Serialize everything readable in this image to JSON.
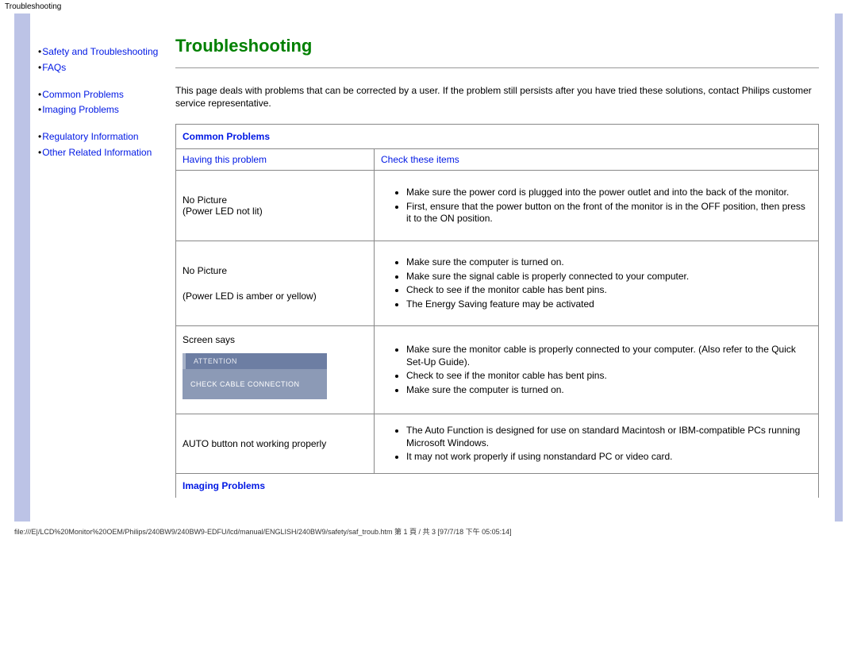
{
  "top_label": "Troubleshooting",
  "sidebar": {
    "links": [
      {
        "label": "Safety and Troubleshooting"
      },
      {
        "label": "FAQs"
      },
      {
        "label": "Common Problems"
      },
      {
        "label": "Imaging Problems"
      },
      {
        "label": "Regulatory Information"
      },
      {
        "label": "Other Related Information"
      }
    ]
  },
  "main": {
    "title": "Troubleshooting",
    "intro": "This page deals with problems that can be corrected by a user. If the problem still persists after you have tried these solutions, contact Philips customer service representative.",
    "sections": {
      "common": {
        "heading": "Common Problems",
        "col_left": "Having this problem",
        "col_right": "Check these items",
        "rows": [
          {
            "problem_line1": "No Picture",
            "problem_line2": "(Power LED not lit)",
            "items": [
              "Make sure the power cord is plugged into the power outlet and into the back of the monitor.",
              "First, ensure that the power button on the front of the monitor is in the OFF position, then press it to the ON position."
            ]
          },
          {
            "problem_line1": "No Picture",
            "problem_line2": "(Power LED is amber or yellow)",
            "items": [
              "Make sure the computer is turned on.",
              "Make sure the signal cable is properly connected to your computer.",
              "Check to see if the monitor cable has bent pins.",
              "The Energy Saving feature may be activated"
            ]
          },
          {
            "problem_line1": "Screen says",
            "attention_head": "ATTENTION",
            "attention_body": "CHECK CABLE CONNECTION",
            "items": [
              "Make sure the monitor cable is properly connected to your computer. (Also refer to the Quick Set-Up Guide).",
              "Check to see if the monitor cable has bent pins.",
              "Make sure the computer is turned on."
            ]
          },
          {
            "problem_line1": "AUTO button not working properly",
            "items": [
              "The Auto Function is designed for use on standard Macintosh or IBM-compatible PCs running Microsoft Windows.",
              "It may not work properly if using nonstandard PC or video card."
            ]
          }
        ]
      },
      "imaging": {
        "heading": "Imaging Problems"
      }
    }
  },
  "footer": "file:///E|/LCD%20Monitor%20OEM/Philips/240BW9/240BW9-EDFU/lcd/manual/ENGLISH/240BW9/safety/saf_troub.htm 第 1 頁 / 共 3  [97/7/18 下午 05:05:14]"
}
